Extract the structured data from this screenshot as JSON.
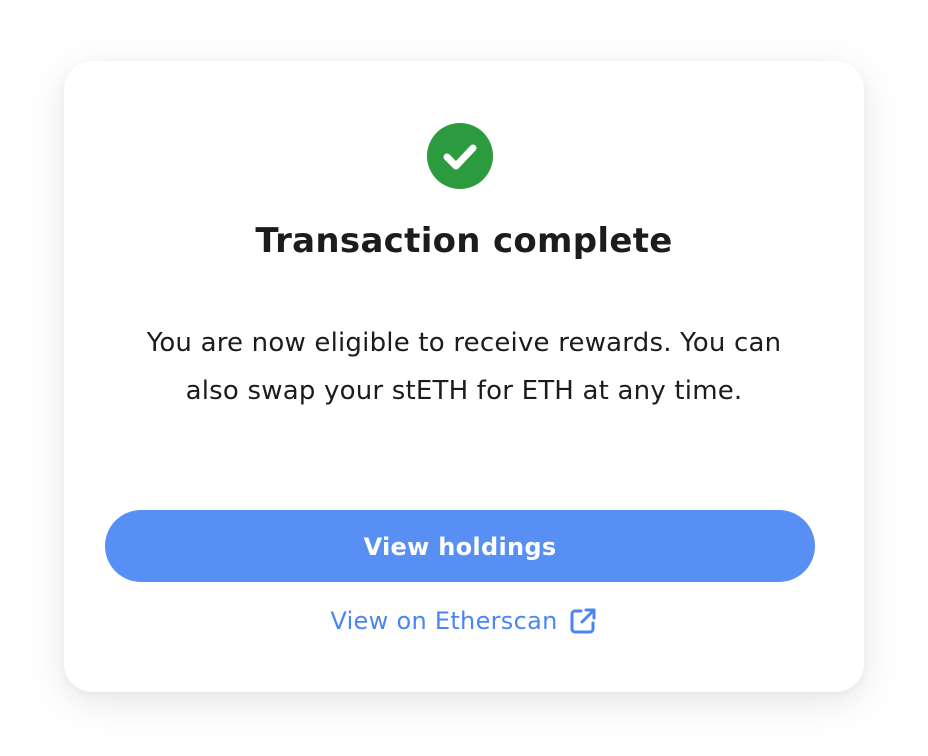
{
  "dialog": {
    "status_icon": "check-circle-icon",
    "title": "Transaction complete",
    "message": "You are now eligible to receive rewards. You can also swap your stETH for ETH at any time.",
    "primary_button_label": "View holdings",
    "link_label": "View on Etherscan",
    "link_icon": "external-link-icon"
  },
  "colors": {
    "success": "#2c9a3f",
    "primary": "#578ff4",
    "link": "#4a86f3",
    "text": "#1c1c1e"
  }
}
